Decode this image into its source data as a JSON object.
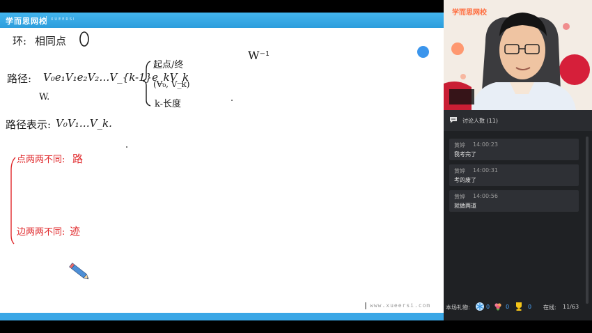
{
  "board": {
    "brand": "学而思网校",
    "brand_sub": "XUEERSI",
    "footer_url": "www.xueersi.com",
    "handwriting": {
      "line1_label": "环:",
      "line1_text": "相同点",
      "line2_label": "路径:",
      "line2_text": "V₀e₁V₁e₂V₂…V_{k-1}e_kV_k",
      "line2_sub": "W.",
      "brace_item1": "起点/终",
      "brace_item2": "(V₀, V_k)",
      "brace_item3": "k-长度",
      "right_mark": "W⁻¹",
      "line3_label": "路径表示:",
      "line3_text": "V₀V₁…V_k.",
      "red_item1": "点两两不同:",
      "red_item1_value": "路",
      "red_item2": "边两两不同:",
      "red_item2_value": "迹"
    }
  },
  "video": {
    "brand": "学而思网校"
  },
  "chat": {
    "title": "讨论人数 (11)",
    "messages": [
      {
        "name": "黄婷",
        "time": "14:00:23",
        "text": "我考完了"
      },
      {
        "name": "黄婷",
        "time": "14:00:31",
        "text": "考的废了"
      },
      {
        "name": "黄婷",
        "time": "14:00:56",
        "text": "就做两道"
      }
    ]
  },
  "footer": {
    "gift_label": "本场礼物:",
    "gifts": [
      {
        "icon": "snowflake-icon",
        "count": "0"
      },
      {
        "icon": "flower-icon",
        "count": "0"
      },
      {
        "icon": "trophy-icon",
        "count": "0"
      }
    ],
    "online_label": "在线:",
    "online_count": "11/63"
  },
  "colors": {
    "accent_blue": "#3aa7e6",
    "ink_red": "#e0282b",
    "sidebar_bg": "#1f2124"
  }
}
